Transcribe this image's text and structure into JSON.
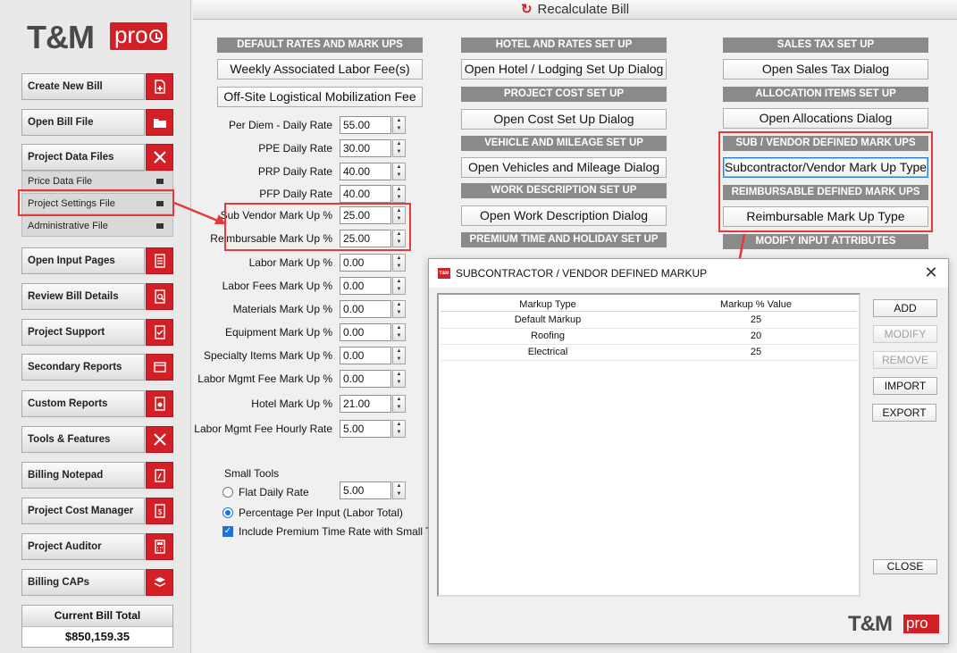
{
  "app": {
    "logo_text": "T&M",
    "logo_pro": "pro",
    "recalc_label": "Recalculate Bill"
  },
  "sidebar": {
    "buttons": [
      {
        "label": "Create New Bill",
        "icon": "file-plus-icon"
      },
      {
        "label": "Open Bill File",
        "icon": "folder-open-icon"
      },
      {
        "label": "Project Data Files",
        "icon": "close-x-icon"
      },
      {
        "label": "Open Input Pages",
        "icon": "list-page-icon"
      },
      {
        "label": "Review Bill Details",
        "icon": "magnify-page-icon"
      },
      {
        "label": "Project Support",
        "icon": "checklist-icon"
      },
      {
        "label": "Secondary Reports",
        "icon": "report-icon"
      },
      {
        "label": "Custom Reports",
        "icon": "gear-page-icon"
      },
      {
        "label": "Tools & Features",
        "icon": "tools-icon"
      },
      {
        "label": "Billing Notepad",
        "icon": "notepad-icon"
      },
      {
        "label": "Project Cost Manager",
        "icon": "dollar-page-icon"
      },
      {
        "label": "Project Auditor",
        "icon": "calculator-icon"
      },
      {
        "label": "Billing CAPs",
        "icon": "layers-icon"
      }
    ],
    "sub_items": [
      {
        "label": "Price Data File"
      },
      {
        "label": "Project Settings File"
      },
      {
        "label": "Administrative File"
      }
    ],
    "total": {
      "title": "Current Bill Total",
      "value": "$850,159.35"
    }
  },
  "col1": {
    "header": "DEFAULT RATES AND MARK UPS",
    "btn1": "Weekly Associated  Labor Fee(s)",
    "btn2": "Off-Site Logistical Mobilization Fee",
    "fields": [
      {
        "label": "Per Diem - Daily Rate",
        "value": "55.00"
      },
      {
        "label": "PPE Daily Rate",
        "value": "30.00"
      },
      {
        "label": "PRP Daily Rate",
        "value": "40.00"
      },
      {
        "label": "PFP Daily Rate",
        "value": "40.00"
      },
      {
        "label": "Sub Vendor Mark Up  %",
        "value": "25.00"
      },
      {
        "label": "Reimbursable Mark Up  %",
        "value": "25.00"
      },
      {
        "label": "Labor Mark Up  %",
        "value": "0.00"
      },
      {
        "label": "Labor Fees Mark Up  %",
        "value": "0.00"
      },
      {
        "label": "Materials Mark Up  %",
        "value": "0.00"
      },
      {
        "label": "Equipment Mark Up  %",
        "value": "0.00"
      },
      {
        "label": "Specialty Items Mark Up  %",
        "value": "0.00"
      },
      {
        "label": "Labor Mgmt Fee Mark Up  %",
        "value": "0.00"
      },
      {
        "label": "Hotel Mark Up  %",
        "value": "21.00"
      },
      {
        "label": "Labor Mgmt Fee Hourly Rate",
        "value": "5.00"
      }
    ],
    "small_tools": {
      "title": "Small Tools",
      "flat_label": "Flat Daily Rate",
      "flat_value": "5.00",
      "pct_label": "Percentage Per Input (Labor Total)",
      "include_label": "Include Premium Time Rate with Small Tools"
    }
  },
  "col2": {
    "sections": [
      {
        "header": "HOTEL AND RATES SET UP",
        "button": "Open Hotel / Lodging Set Up Dialog"
      },
      {
        "header": "PROJECT COST SET UP",
        "button": "Open Cost Set Up Dialog"
      },
      {
        "header": "VEHICLE AND MILEAGE SET UP",
        "button": "Open Vehicles and Mileage Dialog"
      },
      {
        "header": "WORK DESCRIPTION SET UP",
        "button": "Open Work Description Dialog"
      },
      {
        "header": "PREMIUM TIME AND HOLIDAY SET UP",
        "button": ""
      }
    ]
  },
  "col3": {
    "sections": [
      {
        "header": "SALES TAX SET UP",
        "button": "Open Sales Tax Dialog"
      },
      {
        "header": "ALLOCATION ITEMS SET UP",
        "button": "Open Allocations Dialog"
      },
      {
        "header": "SUB / VENDOR DEFINED MARK UPS",
        "button": "Subcontractor/Vendor Mark Up Type"
      },
      {
        "header": "REIMBURSABLE DEFINED MARK UPS",
        "button": "Reimbursable Mark Up Type"
      },
      {
        "header": "MODIFY INPUT ATTRIBUTES",
        "button": ""
      }
    ]
  },
  "dialog": {
    "title": "SUBCONTRACTOR / VENDOR DEFINED MARKUP",
    "icon_text": "T&M",
    "columns": [
      "Markup Type",
      "Markup % Value"
    ],
    "rows": [
      {
        "type": "Default Markup",
        "value": "25"
      },
      {
        "type": "Roofing",
        "value": "20"
      },
      {
        "type": "Electrical",
        "value": "25"
      }
    ],
    "buttons": {
      "add": "ADD",
      "modify": "MODIFY",
      "remove": "REMOVE",
      "import": "IMPORT",
      "export": "EXPORT",
      "close": "CLOSE"
    },
    "logo_text": "T&M",
    "logo_pro": "pro"
  },
  "colors": {
    "brand_red": "#d32026",
    "highlight": "#e53a3a",
    "section_gray": "#8a8a8a",
    "accent_blue": "#1a73d9"
  }
}
